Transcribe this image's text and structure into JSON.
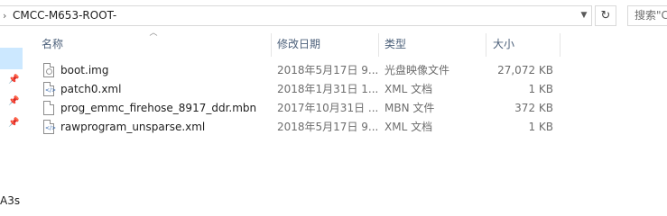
{
  "address_bar": {
    "path": "CMCC-M653-ROOT-"
  },
  "search": {
    "placeholder": "搜索\"C"
  },
  "nav_pane": {
    "visible_label": "A3s"
  },
  "columns": {
    "name": "名称",
    "date_modified": "修改日期",
    "type": "类型",
    "size": "大小"
  },
  "files": [
    {
      "name": "boot.img",
      "date_modified": "2018年5月17日 9...",
      "type": "光盘映像文件",
      "size": "27,072 KB",
      "icon": "disc-image-file-icon"
    },
    {
      "name": "patch0.xml",
      "date_modified": "2018年1月31日 1...",
      "type": "XML 文档",
      "size": "1 KB",
      "icon": "xml-file-icon"
    },
    {
      "name": "prog_emmc_firehose_8917_ddr.mbn",
      "date_modified": "2017年10月31日 ...",
      "type": "MBN 文件",
      "size": "372 KB",
      "icon": "generic-file-icon"
    },
    {
      "name": "rawprogram_unsparse.xml",
      "date_modified": "2018年5月17日 9...",
      "type": "XML 文档",
      "size": "1 KB",
      "icon": "xml-file-icon"
    }
  ]
}
